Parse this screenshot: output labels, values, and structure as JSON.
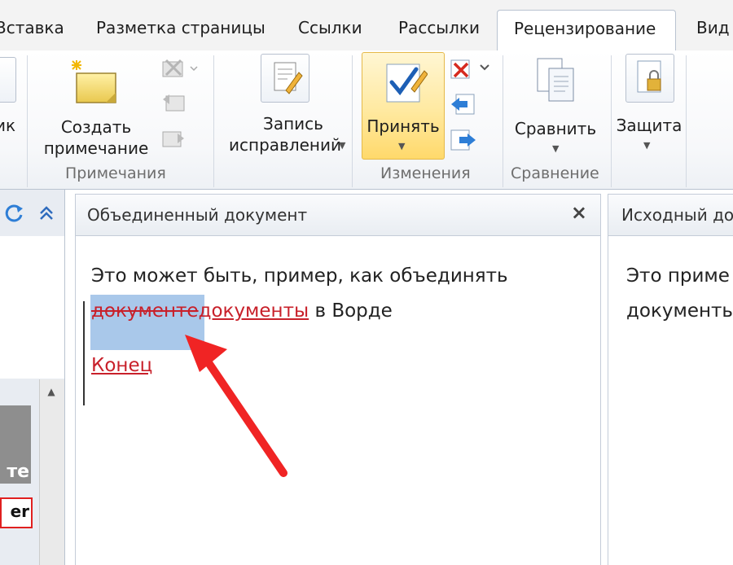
{
  "tabs": {
    "insert": "Вставка",
    "layout": "Разметка страницы",
    "references": "Ссылки",
    "mailings": "Рассылки",
    "review": "Рецензирование",
    "view": "Вид"
  },
  "ribbon": {
    "partial_label": "ик",
    "comments_group": {
      "new_comment_line1": "Создать",
      "new_comment_line2": "примечание",
      "group_label": "Примечания"
    },
    "tracking_group": {
      "track_changes_line1": "Запись",
      "track_changes_line2": "исправлений"
    },
    "changes_group": {
      "accept_label": "Принять",
      "group_label": "Изменения"
    },
    "compare_group": {
      "compare_label": "Сравнить",
      "group_label": "Сравнение"
    },
    "protect_group": {
      "protect_label": "Защита"
    }
  },
  "left_pane": {
    "item_grey_text": "те",
    "item_red_text": "er"
  },
  "merged_document": {
    "title": "Объединенный документ",
    "close_icon": "×",
    "line1": "Это может быть, пример, как объединять",
    "deleted_text": "документе",
    "inserted_text": "документы",
    "line2_tail": " в Ворде",
    "inserted_end": "Конец"
  },
  "source_document": {
    "title": "Исходный до",
    "line1": "Это приме",
    "line2": "документы"
  },
  "colors": {
    "revision_red": "#c8202a",
    "selection_blue": "#a9c8ea",
    "arrow_red": "#f02424",
    "accept_highlight": "#ffe9a0"
  }
}
